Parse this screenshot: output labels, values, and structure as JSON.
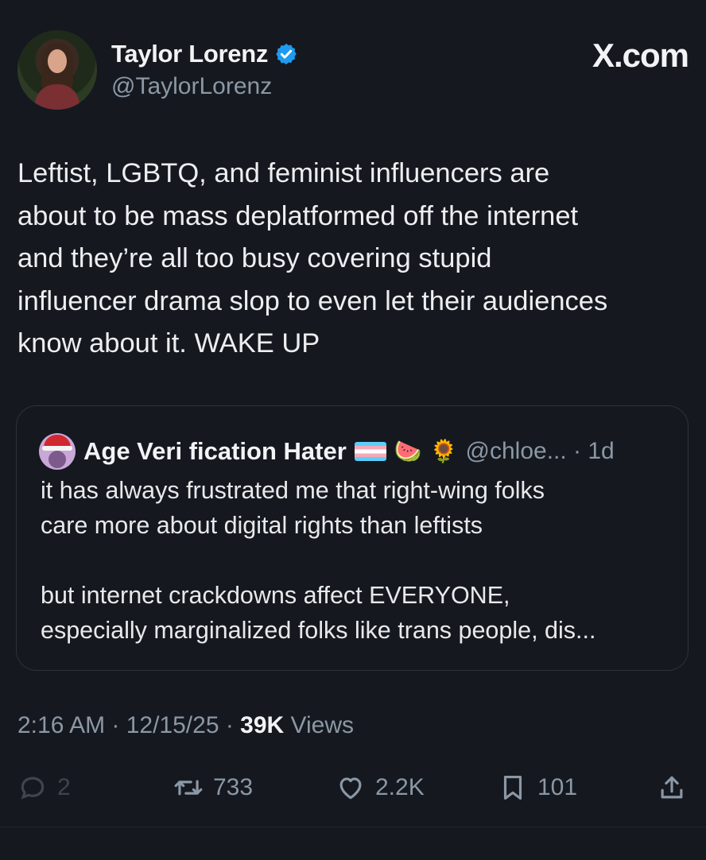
{
  "brand": "X.com",
  "author": {
    "name": "Taylor Lorenz",
    "handle": "@TaylorLorenz",
    "verified_icon": "verified-badge-icon"
  },
  "tweet": {
    "text": "Leftist, LGBTQ, and feminist influencers are\nabout to be mass deplatformed off the internet\nand they’re all too busy covering stupid\ninfluencer drama slop to even let their audiences\nknow about it. WAKE UP"
  },
  "quote": {
    "name": "Age Veri fication Hater",
    "emojis": [
      "🍉",
      "🌻"
    ],
    "handle_time": "@chloe... · 1d",
    "text": "it has always frustrated me that right-wing folks\ncare more about digital rights than leftists\n\nbut internet crackdowns affect EVERYONE,\nespecially marginalized folks like trans people, dis..."
  },
  "meta": {
    "time_date": "2:16 AM · 12/15/25 · ",
    "views_count": "39K",
    "views_label": " Views"
  },
  "actions": {
    "replies": "2",
    "reposts": "733",
    "likes": "2.2K",
    "bookmarks": "101"
  },
  "colors": {
    "background": "#15181f",
    "verified": "#1d9bf0",
    "secondary_text": "#8b98a5"
  }
}
